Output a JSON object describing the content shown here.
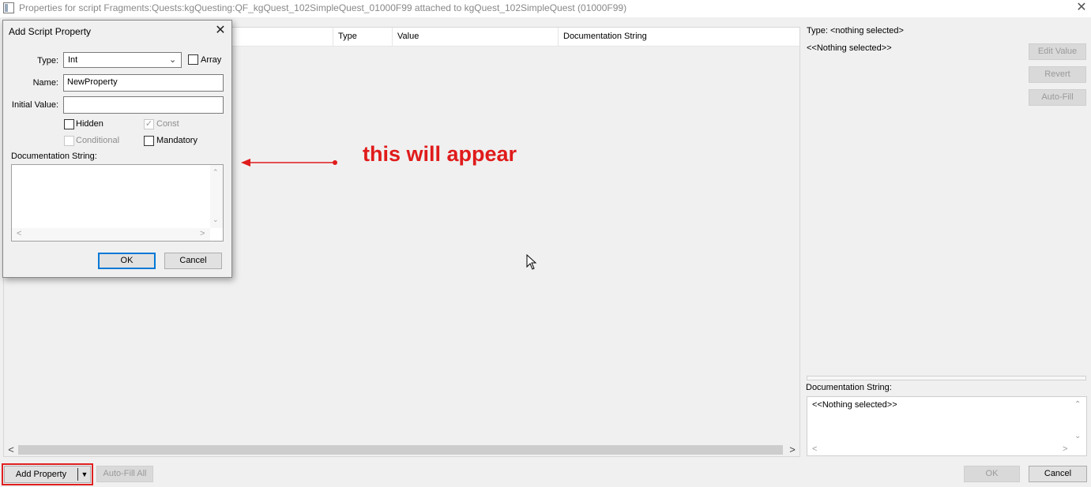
{
  "window": {
    "title": "Properties for script Fragments:Quests:kgQuesting:QF_kgQuest_102SimpleQuest_01000F99 attached to kgQuest_102SimpleQuest (01000F99)",
    "close_glyph": "✕"
  },
  "table": {
    "columns": [
      "Type",
      "Value",
      "Documentation String"
    ],
    "scroll_left": "<",
    "scroll_right": ">"
  },
  "toolbar": {
    "add_property_label": "Add Property",
    "dropdown_glyph": "▼",
    "autofill_all_label": "Auto-Fill All"
  },
  "right_panel": {
    "type_label": "Type: <nothing selected>",
    "nothing_selected": "<<Nothing selected>>",
    "edit_value_label": "Edit Value",
    "revert_label": "Revert",
    "autofill_label": "Auto-Fill",
    "doc_string_label": "Documentation String:",
    "doc_string_value": "<<Nothing selected>>",
    "ok_label": "OK",
    "cancel_label": "Cancel"
  },
  "dialog": {
    "title": "Add Script Property",
    "close_glyph": "✕",
    "type_label": "Type:",
    "type_value": "Int",
    "array_label": "Array",
    "name_label": "Name:",
    "name_value": "NewProperty",
    "initial_value_label": "Initial Value:",
    "initial_value": "",
    "hidden_label": "Hidden",
    "const_label": "Const",
    "conditional_label": "Conditional",
    "mandatory_label": "Mandatory",
    "doc_string_label": "Documentation String:",
    "ok_label": "OK",
    "cancel_label": "Cancel",
    "checks": {
      "array": false,
      "hidden": false,
      "const": true,
      "conditional": false,
      "mandatory": false
    }
  },
  "annotation": {
    "text": "this will appear",
    "color": "#e01b1b"
  },
  "icons": {
    "app": "app-icon",
    "cursor": "mouse-cursor-icon",
    "arrow": "red-arrow-icon"
  }
}
